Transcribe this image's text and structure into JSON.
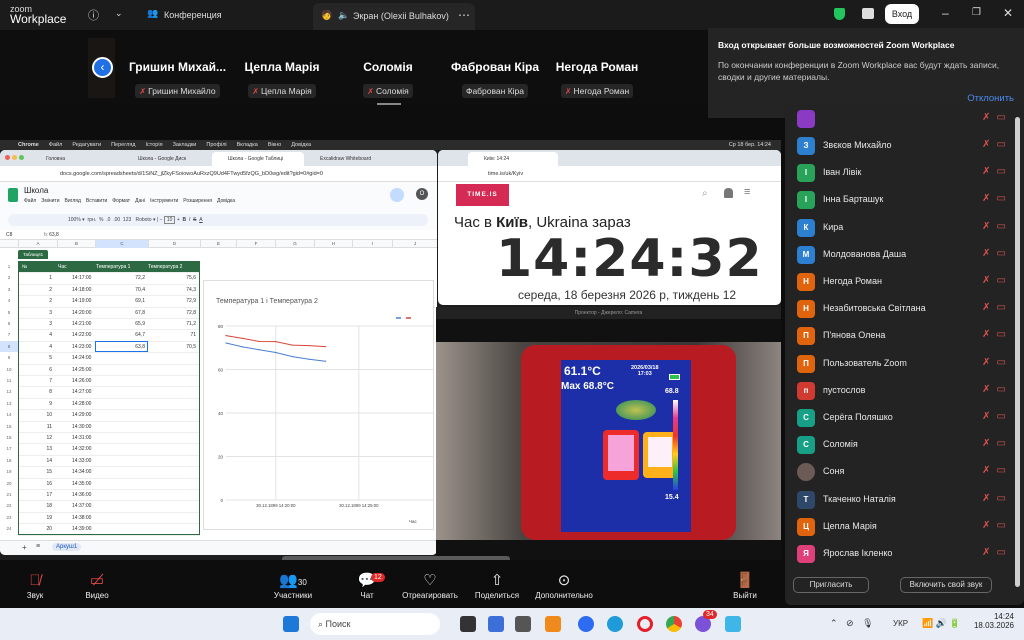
{
  "topbar": {
    "logo_small": "zoom",
    "logo_big": "Workplace",
    "meeting_label": "Конференция",
    "share_label": "Экран (Olexii Bulhakov)",
    "signin": "Вход"
  },
  "strip": {
    "tiles": [
      {
        "name": "Гришин  Михай...",
        "label": "Гришин Михайло",
        "muted": true
      },
      {
        "name": "Цепла Марія",
        "label": "Цепла Марія",
        "muted": true
      },
      {
        "name": "Соломія",
        "label": "Соломія",
        "muted": true
      },
      {
        "name": "Фаброван Кіра",
        "label": "Фаброван Кіра",
        "muted": false
      },
      {
        "name": "Негода Роман",
        "label": "Негода Роман",
        "muted": true
      }
    ]
  },
  "notification": {
    "title": "Вход открывает больше возможностей Zoom Workplace",
    "text": "По окончании конференции в Zoom Workplace вас будут ждать записи, сводки и другие материалы.",
    "dismiss": "Отклонить"
  },
  "mac": {
    "menu": [
      "Chrome",
      "Файл",
      "Редагувати",
      "Перегляд",
      "Історія",
      "Закладки",
      "Профілі",
      "Вкладка",
      "Вікно",
      "Довідка"
    ],
    "clock": "Ср 18 бер.  14:24"
  },
  "chrome": {
    "tabs": [
      "Головна",
      "Школа - Google Диск",
      "Школа - Google Таблиці",
      "Excalidraw Whiteboard"
    ],
    "url": "docs.google.com/spreadsheets/d/1SiNZ_jlZkyFSoiowoAuRxzQ9Ud4FTwyd5fzQG_bD0wg/edit?gid=0#gid=0"
  },
  "sheet": {
    "title": "Школа",
    "menu": [
      "Файл",
      "Змінити",
      "Вигляд",
      "Вставити",
      "Формат",
      "Дані",
      "Інструменти",
      "Розширення",
      "Довідка"
    ],
    "toolbar": {
      "zoom": "100%",
      "currency": "грн.",
      "font": "Roboto",
      "size": "10"
    },
    "cellref": "C8",
    "formula": "63,8",
    "columns": [
      "A",
      "B",
      "C",
      "D",
      "E",
      "F",
      "G",
      "H",
      "I",
      "J"
    ],
    "table_name": "Таблиця1",
    "headers": [
      "№",
      "Час",
      "Температура 1",
      "Температура 2"
    ],
    "rows": [
      [
        "1",
        "14:17:00",
        "72,2",
        "75,6"
      ],
      [
        "2",
        "14:18:00",
        "70,4",
        "74,3"
      ],
      [
        "2",
        "14:19:00",
        "69,1",
        "72,9"
      ],
      [
        "3",
        "14:20:00",
        "67,8",
        "72,8"
      ],
      [
        "3",
        "14:21:00",
        "65,9",
        "71,2"
      ],
      [
        "4",
        "14:22:00",
        "64,7",
        "71"
      ],
      [
        "4",
        "14:23:00",
        "63,8",
        "70,5"
      ],
      [
        "5",
        "14:24:00",
        "",
        ""
      ],
      [
        "6",
        "14:25:00",
        "",
        ""
      ],
      [
        "7",
        "14:26:00",
        "",
        ""
      ],
      [
        "8",
        "14:27:00",
        "",
        ""
      ],
      [
        "9",
        "14:28:00",
        "",
        ""
      ],
      [
        "10",
        "14:29:00",
        "",
        ""
      ],
      [
        "11",
        "14:30:00",
        "",
        ""
      ],
      [
        "12",
        "14:31:00",
        "",
        ""
      ],
      [
        "13",
        "14:32:00",
        "",
        ""
      ],
      [
        "14",
        "14:33:00",
        "",
        ""
      ],
      [
        "15",
        "14:34:00",
        "",
        ""
      ],
      [
        "16",
        "14:35:00",
        "",
        ""
      ],
      [
        "17",
        "14:36:00",
        "",
        ""
      ],
      [
        "18",
        "14:37:00",
        "",
        ""
      ],
      [
        "19",
        "14:38:00",
        "",
        ""
      ],
      [
        "20",
        "14:39:00",
        "",
        ""
      ]
    ],
    "sheet_tab": "Аркуш1"
  },
  "chart_data": {
    "type": "line",
    "title": "Температура 1  і Температура 2",
    "xlabel": "Час",
    "ylabel": "",
    "x": [
      "14:17",
      "14:18",
      "14:19",
      "14:20",
      "14:21",
      "14:22",
      "14:23"
    ],
    "x_ticks": [
      "30.12.1899 14:20:00",
      "30.12.1899 14:25:00",
      "30.12"
    ],
    "ylim": [
      0,
      80
    ],
    "y_ticks": [
      "0",
      "20",
      "40",
      "60",
      "80"
    ],
    "series": [
      {
        "name": "Температура 1",
        "color": "#4a7fd4",
        "values": [
          72.2,
          70.4,
          69.1,
          67.8,
          65.9,
          64.7,
          63.8
        ]
      },
      {
        "name": "Температура 2",
        "color": "#d9443a",
        "values": [
          75.6,
          74.3,
          72.9,
          72.8,
          71.2,
          71.0,
          70.5
        ]
      }
    ]
  },
  "timeis": {
    "tab": "Київ: 14:24",
    "url": "time.is/uk/Kyiv",
    "logo": "TIME.IS",
    "heading_pre": "Час в ",
    "heading_city": "Київ",
    "heading_post": ", Ukraina зараз",
    "time": "14:24:32",
    "date": "середа, 18 березня 2026 р, тиждень 12"
  },
  "camera": {
    "title": "Проектор - Джерело: Camera",
    "temp": "61.1°C",
    "max": "Max 68.8°C",
    "date": "2026/03/18",
    "time": "17:03",
    "scale_max": "68.8",
    "scale_min": "15.4"
  },
  "participants": [
    {
      "i": "З",
      "name": "Звєков Михайло",
      "c": "#2d7fd0"
    },
    {
      "i": "І",
      "name": "Іван Лівік",
      "c": "#2aa35a"
    },
    {
      "i": "І",
      "name": "Інна Барташук",
      "c": "#2aa35a"
    },
    {
      "i": "К",
      "name": "Кира",
      "c": "#2d7fd0"
    },
    {
      "i": "М",
      "name": "Молдованова Даша",
      "c": "#2d7fd0"
    },
    {
      "i": "Н",
      "name": "Негода Роман",
      "c": "#e0640e"
    },
    {
      "i": "Н",
      "name": "Незабитовська Світлана",
      "c": "#e0640e"
    },
    {
      "i": "П",
      "name": "П'янова Олена",
      "c": "#e0640e"
    },
    {
      "i": "П",
      "name": "Пользователь Zoom",
      "c": "#e0640e"
    },
    {
      "i": "п",
      "name": "пустослов",
      "c": "#d03a30"
    },
    {
      "i": "С",
      "name": "Серёга Поляшко",
      "c": "#17a085"
    },
    {
      "i": "С",
      "name": "Соломія",
      "c": "#17a085"
    },
    {
      "i": "",
      "name": "Соня",
      "c": "#6b5a55"
    },
    {
      "i": "Т",
      "name": "Ткаченко Наталія",
      "c": "#2d4868"
    },
    {
      "i": "Ц",
      "name": "Цепла Марія",
      "c": "#e0640e"
    },
    {
      "i": "Я",
      "name": "Ярослав Ікленко",
      "c": "#e0407a"
    }
  ],
  "panel": {
    "invite": "Пригласить",
    "unmute": "Включить свой звук"
  },
  "controls": {
    "audio": "Звук",
    "video": "Видео",
    "participants": "Участники",
    "participants_count": "30",
    "chat": "Чат",
    "chat_badge": "12",
    "react": "Отреагировать",
    "share": "Поделиться",
    "more": "Дополнительно",
    "leave": "Выйти"
  },
  "taskbar": {
    "search": "Поиск",
    "lang": "УКР",
    "time": "14:24",
    "date": "18.03.2026",
    "viber_badge": "34"
  }
}
